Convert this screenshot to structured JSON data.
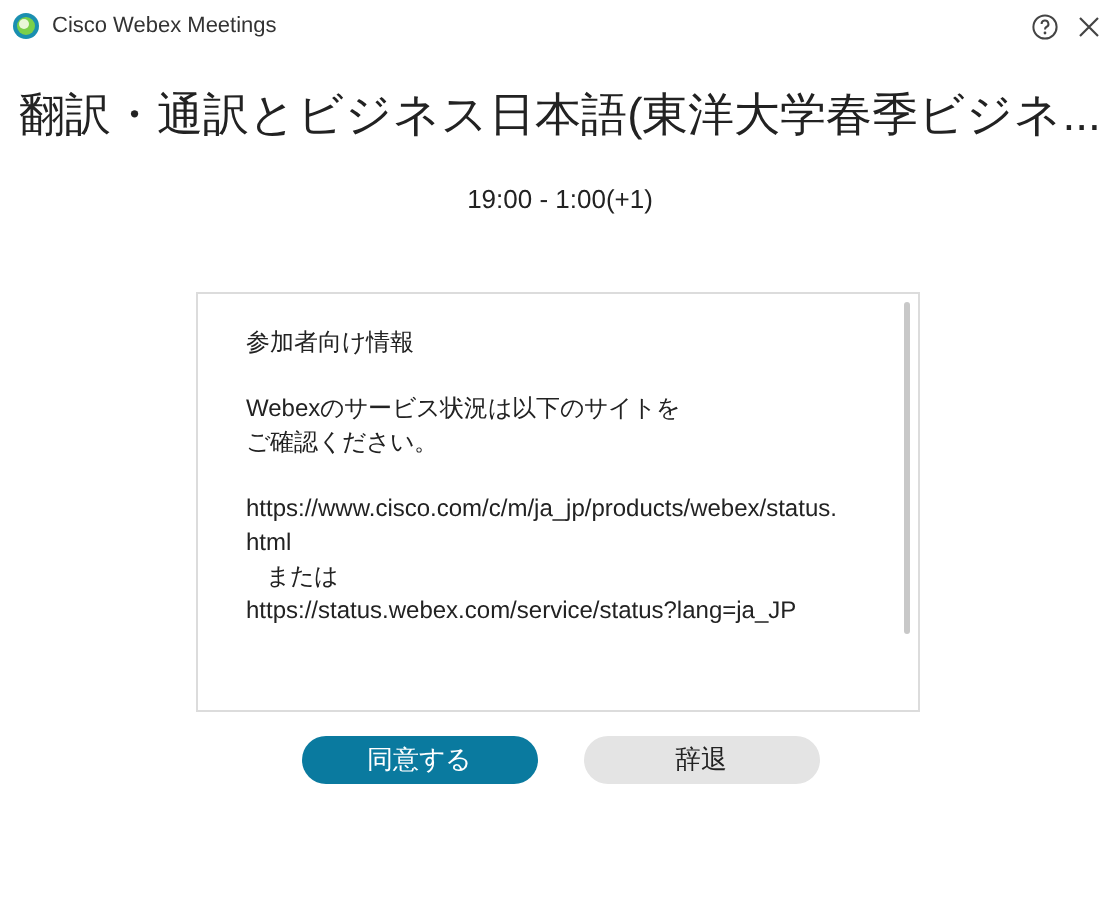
{
  "window": {
    "title": "Cisco Webex Meetings"
  },
  "meeting": {
    "title": "翻訳・通訳とビジネス日本語(東洋大学春季ビジネ...",
    "time": "19:00 - 1:00(+1)"
  },
  "info": {
    "paragraphs": [
      {
        "lines": [
          "参加者向け情報"
        ]
      },
      {
        "lines": [
          "Webexのサービス状況は以下のサイトを",
          "ご確認ください。"
        ]
      },
      {
        "lines": [
          "https://www.cisco.com/c/m/ja_jp/products/webex/status.\nhtml",
          "   または",
          "https://status.webex.com/service/status?lang=ja_JP"
        ]
      }
    ]
  },
  "buttons": [
    {
      "label": "同意する",
      "kind": "primary"
    },
    {
      "label": "辞退",
      "kind": "secondary"
    }
  ]
}
